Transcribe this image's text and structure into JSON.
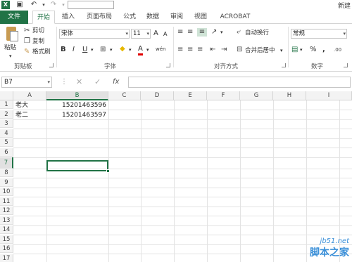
{
  "titlebar": {
    "title": "新建"
  },
  "tabs": [
    {
      "label": "文件"
    },
    {
      "label": "开始"
    },
    {
      "label": "插入"
    },
    {
      "label": "页面布局"
    },
    {
      "label": "公式"
    },
    {
      "label": "数据"
    },
    {
      "label": "审阅"
    },
    {
      "label": "视图"
    },
    {
      "label": "ACROBAT"
    }
  ],
  "clipboard": {
    "paste_label": "粘贴",
    "cut_label": "剪切",
    "copy_label": "复制",
    "format_painter_label": "格式刷",
    "group_label": "剪贴板"
  },
  "font": {
    "name": "宋体",
    "size": "11",
    "grow": "A",
    "shrink": "A",
    "bold": "B",
    "italic": "I",
    "underline": "U",
    "font_color": "A",
    "phonetic": "wén",
    "group_label": "字体"
  },
  "alignment": {
    "wrap_text_label": "自动换行",
    "merge_center_label": "合并后居中",
    "group_label": "对齐方式"
  },
  "number": {
    "format": "常规",
    "percent": "%",
    "comma": ",",
    "group_label": "数字"
  },
  "formula_bar": {
    "cell_ref": "B7",
    "fx": "fx",
    "content": ""
  },
  "grid": {
    "columns": [
      "A",
      "B",
      "C",
      "D",
      "E",
      "F",
      "G",
      "H",
      "I"
    ],
    "rows": [
      "1",
      "2",
      "3",
      "4",
      "5",
      "6",
      "7",
      "8",
      "9",
      "10",
      "11",
      "12",
      "13",
      "14",
      "15",
      "16",
      "17"
    ],
    "cells": [
      {
        "a": "老大",
        "b": "15201463596"
      },
      {
        "a": "老二",
        "b": "15201463597"
      }
    ],
    "selected_column": "B",
    "selected_row": "7"
  },
  "watermark": {
    "site": "jb51.net",
    "brand": "脚本之家"
  },
  "colors": {
    "accent": "#217346",
    "header_bg": "#f3f3f3",
    "watermark": "#3a8fd8"
  }
}
